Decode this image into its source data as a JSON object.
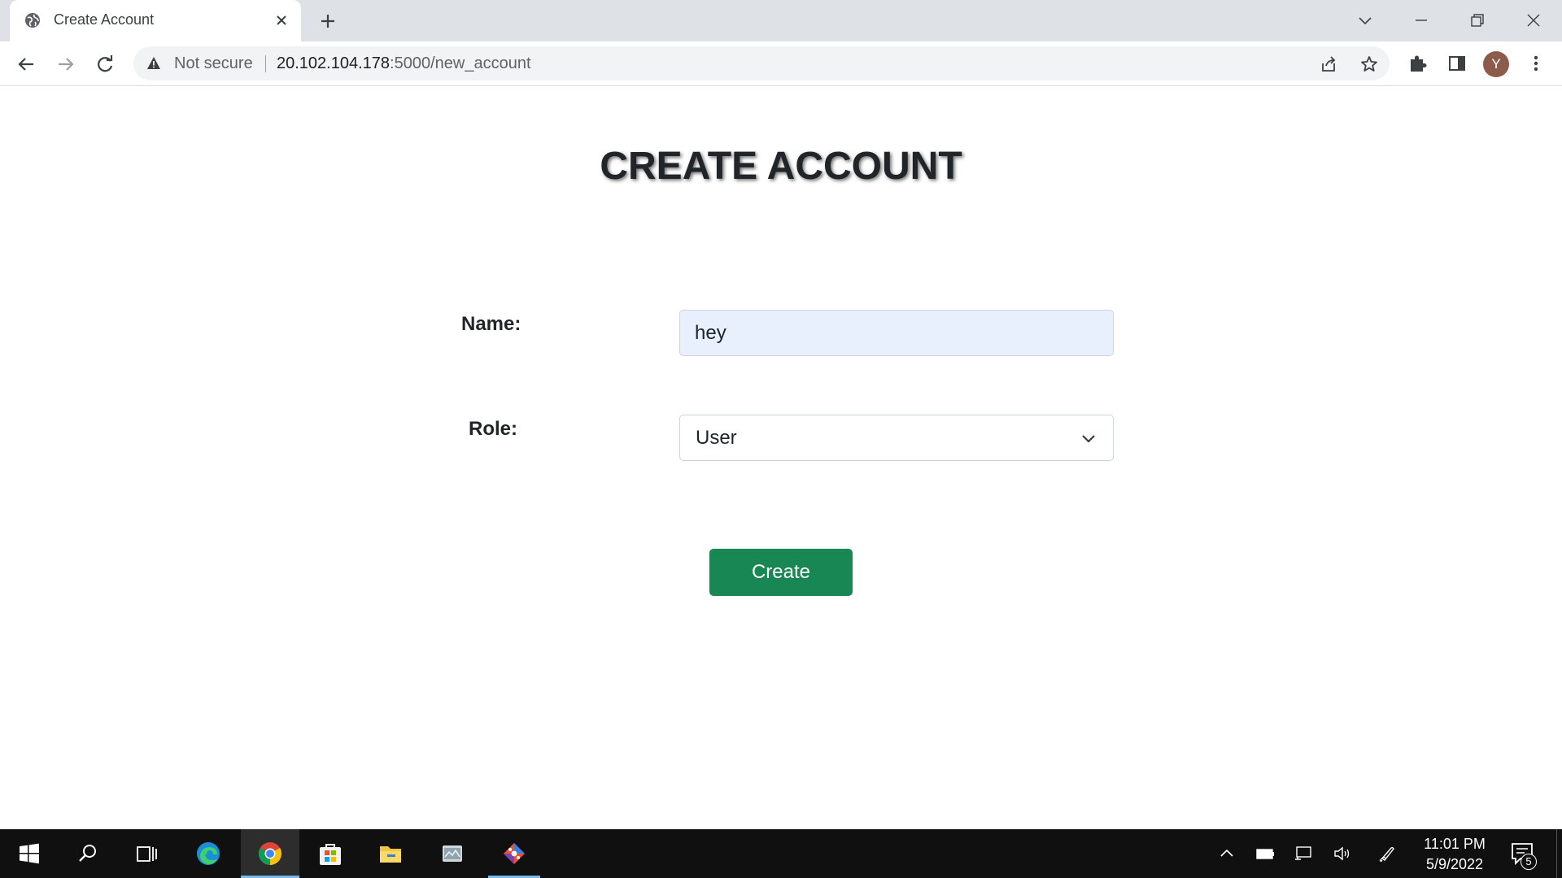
{
  "browser": {
    "tab_title": "Create Account",
    "omnibox": {
      "security_text": "Not secure",
      "url_host": "20.102.104.178",
      "url_path": ":5000/new_account"
    },
    "profile_initial": "Y"
  },
  "page": {
    "title": "CREATE ACCOUNT",
    "form": {
      "name_label": "Name:",
      "name_value": "hey",
      "role_label": "Role:",
      "role_value": "User",
      "submit_label": "Create"
    }
  },
  "taskbar": {
    "time": "11:01 PM",
    "date": "5/9/2022",
    "notification_count": "5"
  },
  "colors": {
    "primary_button": "#198754",
    "autofill_bg": "#e8f0fe",
    "taskbar_bg": "#101010"
  },
  "icons": [
    "globe-icon",
    "close-icon",
    "plus-icon",
    "chevron-down-icon",
    "minimize-icon",
    "restore-icon",
    "back-icon",
    "forward-icon",
    "reload-icon",
    "warning-icon",
    "share-icon",
    "star-icon",
    "extensions-icon",
    "side-panel-icon",
    "kebab-menu-icon",
    "windows-start-icon",
    "search-icon",
    "task-view-icon",
    "edge-icon",
    "chrome-icon",
    "store-icon",
    "file-explorer-icon",
    "app-icon",
    "git-icon",
    "tray-chevron-icon",
    "battery-icon",
    "network-icon",
    "volume-icon",
    "pen-icon",
    "notification-icon"
  ]
}
